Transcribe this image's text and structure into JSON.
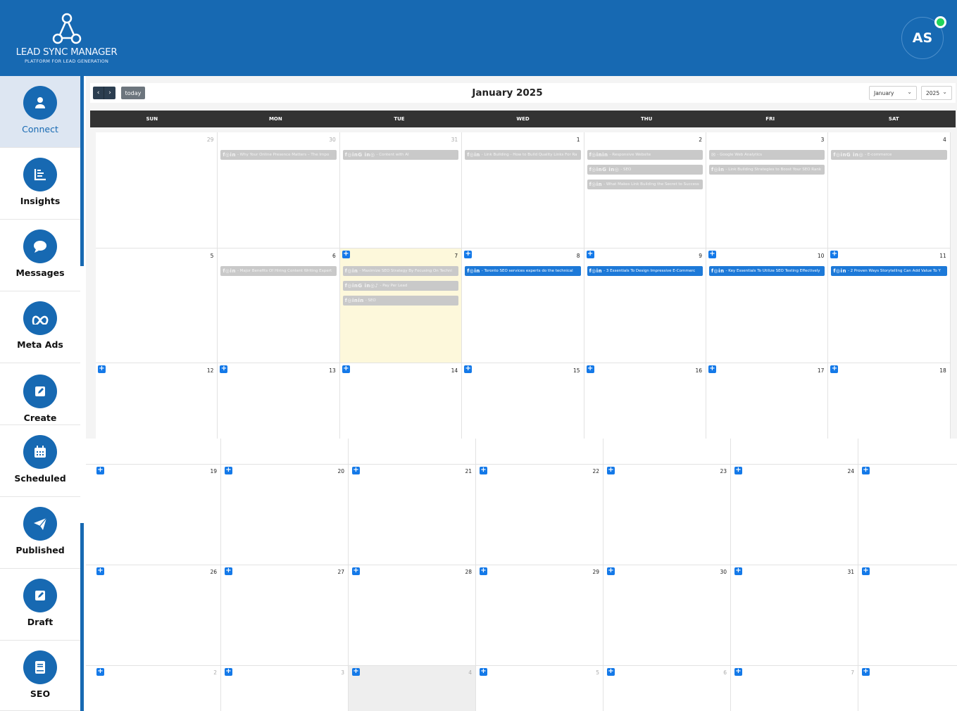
{
  "brand": {
    "name": "LEAD SYNC MANAGER",
    "tagline": "PLATFORM FOR LEAD GENERATION"
  },
  "user": {
    "initials": "AS",
    "status_color": "#22d35b"
  },
  "colors": {
    "primary": "#1769b2",
    "accent": "#1479e8",
    "today": "#fdf8db",
    "header_dark": "#333333"
  },
  "sidebar": {
    "items": [
      {
        "label": "Connect",
        "icon": "user-icon",
        "active": true
      },
      {
        "label": "Insights",
        "icon": "chart-icon"
      },
      {
        "label": "Messages",
        "icon": "chat-bubble-icon"
      },
      {
        "label": "Meta Ads",
        "icon": "meta-infinity-icon"
      },
      {
        "label": "Create",
        "icon": "edit-icon"
      },
      {
        "label": "Scheduled",
        "icon": "calendar-icon"
      },
      {
        "label": "Published",
        "icon": "paper-plane-icon"
      },
      {
        "label": "Draft",
        "icon": "edit-square-icon"
      },
      {
        "label": "SEO",
        "icon": "book-icon"
      }
    ]
  },
  "toolbar": {
    "prev": "‹",
    "next": "›",
    "today_label": "today",
    "title": "January 2025",
    "month_select": "January",
    "year_select": "2025"
  },
  "weekdays": [
    "SUN",
    "MON",
    "TUE",
    "WED",
    "THU",
    "FRI",
    "SAT"
  ],
  "weeks_top": [
    [
      {
        "day": "29",
        "other": true,
        "plus": false
      },
      {
        "day": "30",
        "other": true,
        "plus": false,
        "events": [
          {
            "text": "- Why Your Online Presence Matters – The Impo",
            "icons": "f◎in",
            "past": true
          }
        ]
      },
      {
        "day": "31",
        "other": true,
        "plus": false,
        "events": [
          {
            "text": "- Content with AI",
            "icons": "f◎inG in◎",
            "past": true
          }
        ]
      },
      {
        "day": "1",
        "plus": false,
        "events": [
          {
            "text": "- Link Building - How to Build Quality Links For Ra",
            "icons": "f◎in",
            "past": true
          }
        ]
      },
      {
        "day": "2",
        "plus": false,
        "events": [
          {
            "text": "- Responsive Website",
            "icons": "f◎inin",
            "past": true
          },
          {
            "text": "- SEO",
            "icons": "f◎inG in◎",
            "past": true
          },
          {
            "text": "- What Makes Link Building the Secret to Success",
            "icons": "f◎in",
            "past": true
          }
        ]
      },
      {
        "day": "3",
        "plus": false,
        "events": [
          {
            "text": "- Google Web Analytics",
            "icons": "✉",
            "past": true
          },
          {
            "text": "- Link Building Strategies to Boost Your SEO Rank",
            "icons": "f◎in",
            "past": true
          }
        ]
      },
      {
        "day": "4",
        "plus": false,
        "events": [
          {
            "text": "- E-commerce",
            "icons": "f◎inG in◎",
            "past": true
          }
        ]
      }
    ],
    [
      {
        "day": "5",
        "plus": false
      },
      {
        "day": "6",
        "plus": false,
        "events": [
          {
            "text": "- Major Benefits Of Hiring Content Writing Expert",
            "icons": "f◎in",
            "past": true
          }
        ]
      },
      {
        "day": "7",
        "plus": true,
        "today": true,
        "events": [
          {
            "text": "- Maximize SEO Strategy By Focusing On Techni",
            "icons": "f◎in",
            "past": true
          },
          {
            "text": "- Pay Per Lead",
            "icons": "f◎inG in◎♪",
            "past": true
          },
          {
            "text": "- SEO",
            "icons": "f◎inin",
            "past": true
          }
        ]
      },
      {
        "day": "8",
        "plus": true,
        "events": [
          {
            "text": "- Toronto SEO services experts do the technical",
            "icons": "f◎in",
            "past": false
          }
        ]
      },
      {
        "day": "9",
        "plus": true,
        "events": [
          {
            "text": "- 3 Essentials To Design Impressive E-Commerc",
            "icons": "f◎in",
            "past": false
          }
        ]
      },
      {
        "day": "10",
        "plus": true,
        "events": [
          {
            "text": "- Key Essentials To Utilize SEO Testing Effectively",
            "icons": "f◎in",
            "past": false
          }
        ]
      },
      {
        "day": "11",
        "plus": true,
        "events": [
          {
            "text": "- 2 Proven Ways Storytelling Can Add Value To Y",
            "icons": "f◎in",
            "past": false
          }
        ]
      }
    ],
    [
      {
        "day": "12",
        "plus": true
      },
      {
        "day": "13",
        "plus": true
      },
      {
        "day": "14",
        "plus": true
      },
      {
        "day": "15",
        "plus": true
      },
      {
        "day": "16",
        "plus": true
      },
      {
        "day": "17",
        "plus": true
      },
      {
        "day": "18",
        "plus": true
      }
    ]
  ],
  "weeks_bottom": [
    [
      {
        "day": "19"
      },
      {
        "day": "20"
      },
      {
        "day": "21"
      },
      {
        "day": "22"
      },
      {
        "day": "23"
      },
      {
        "day": "24"
      },
      {
        "day": ""
      }
    ],
    [
      {
        "day": "26"
      },
      {
        "day": "27"
      },
      {
        "day": "28"
      },
      {
        "day": "29"
      },
      {
        "day": "30"
      },
      {
        "day": "31"
      },
      {
        "day": ""
      }
    ],
    [
      {
        "day": "2",
        "other": true
      },
      {
        "day": "3",
        "other": true
      },
      {
        "day": "4",
        "other": true,
        "gray": true
      },
      {
        "day": "5",
        "other": true
      },
      {
        "day": "6",
        "other": true
      },
      {
        "day": "7",
        "other": true
      },
      {
        "day": ""
      }
    ]
  ]
}
